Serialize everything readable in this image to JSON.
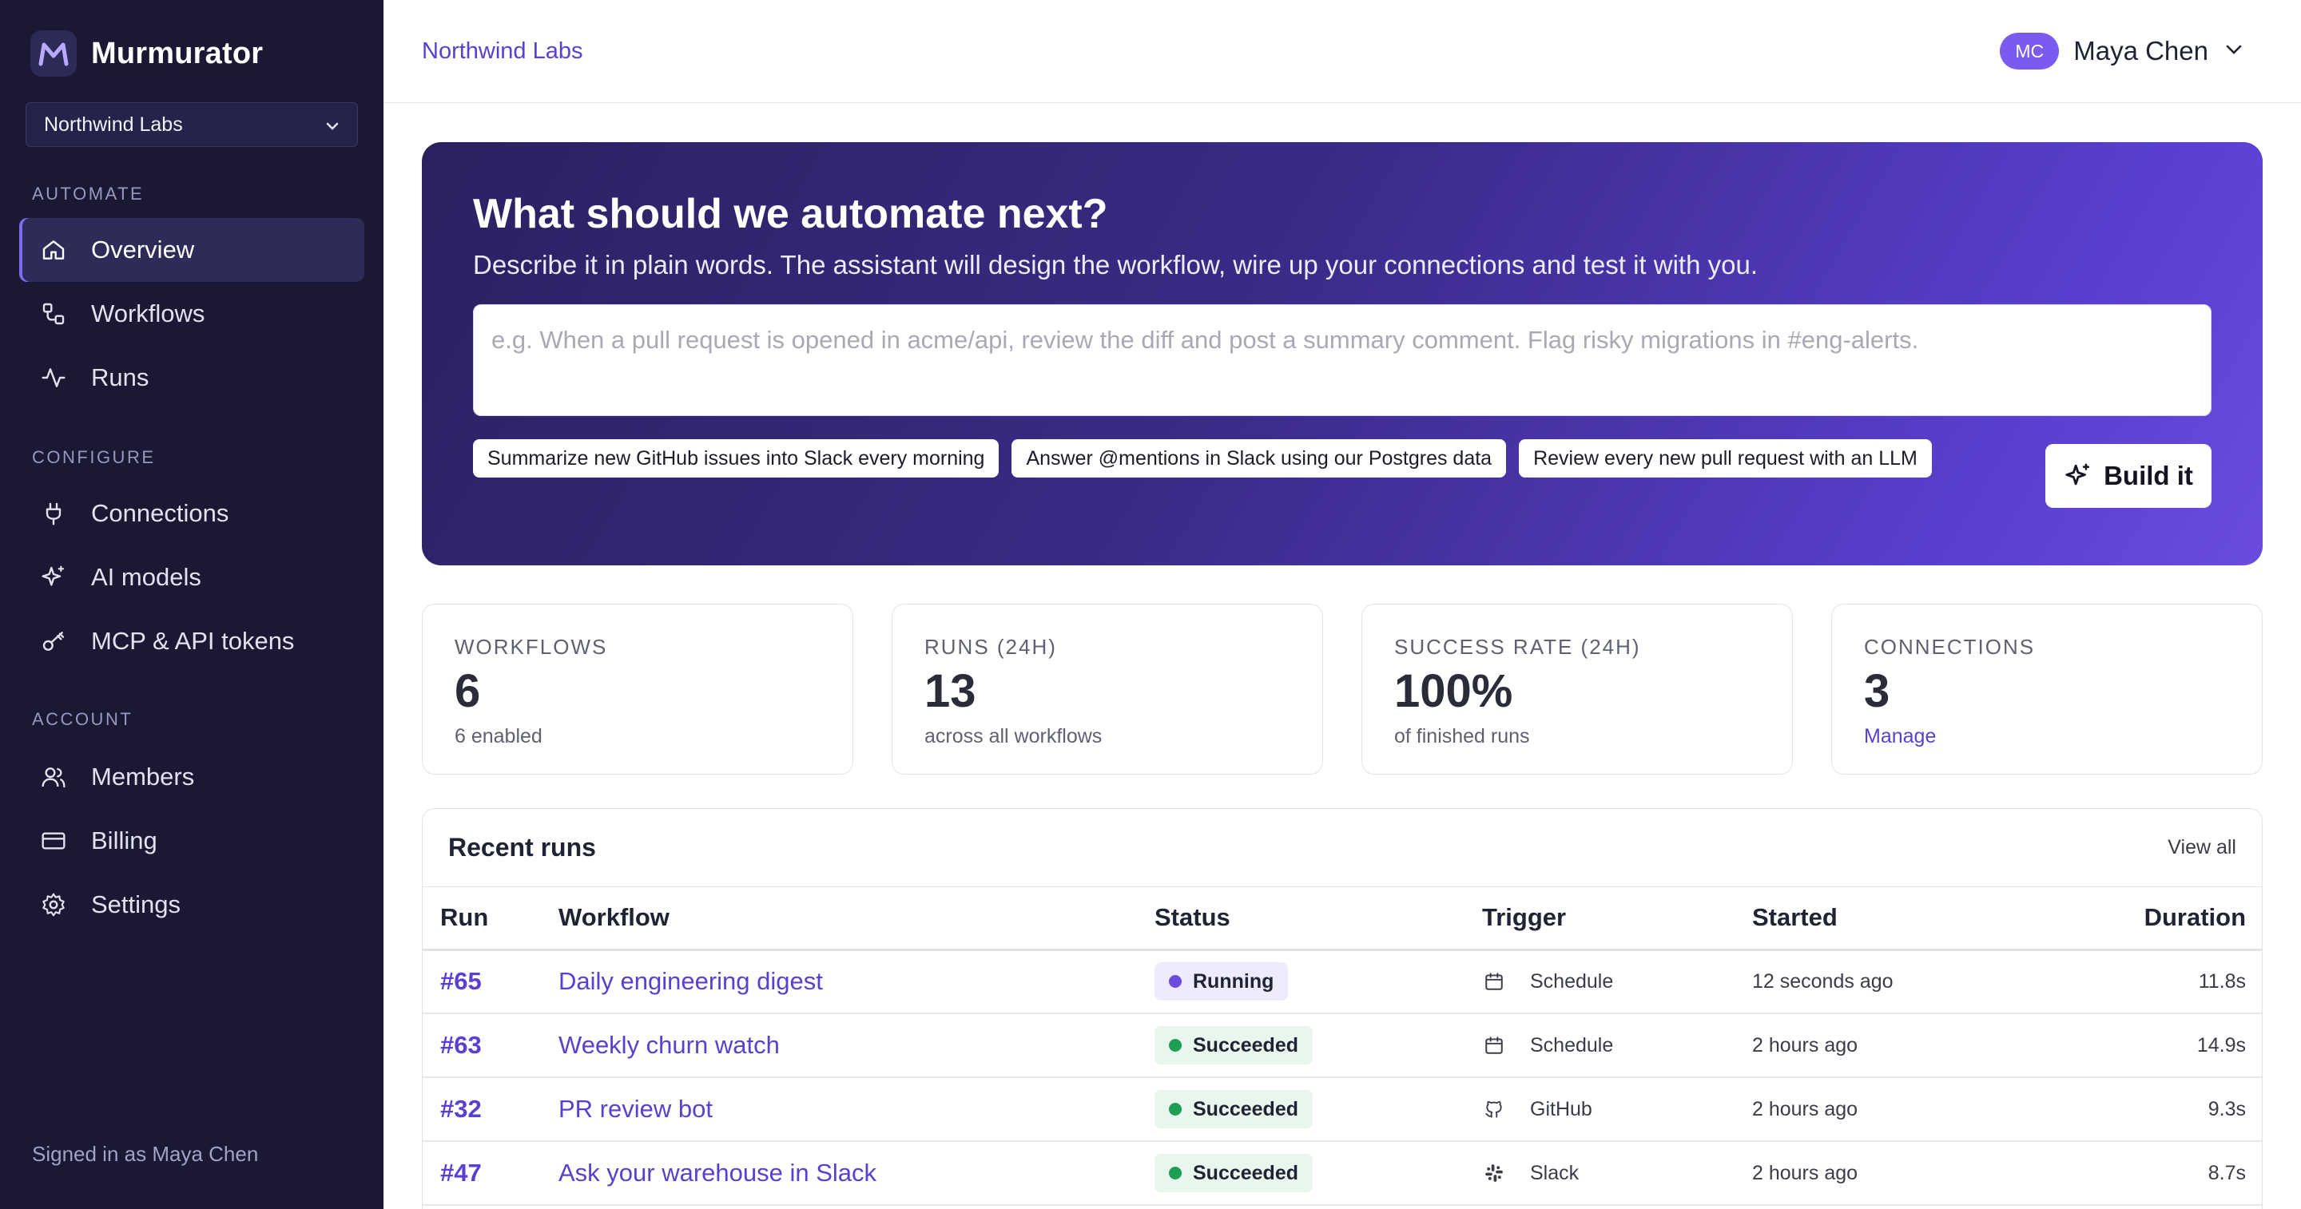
{
  "app": {
    "name": "Murmurator"
  },
  "sidebar": {
    "org_select": "Northwind Labs",
    "sections": [
      {
        "title": "AUTOMATE",
        "items": [
          {
            "label": "Overview",
            "icon": "home-icon",
            "active": true
          },
          {
            "label": "Workflows",
            "icon": "workflow-icon"
          },
          {
            "label": "Runs",
            "icon": "activity-icon"
          }
        ]
      },
      {
        "title": "CONFIGURE",
        "items": [
          {
            "label": "Connections",
            "icon": "plug-icon"
          },
          {
            "label": "AI models",
            "icon": "sparkles-icon"
          },
          {
            "label": "MCP & API tokens",
            "icon": "key-icon"
          }
        ]
      },
      {
        "title": "ACCOUNT",
        "items": [
          {
            "label": "Members",
            "icon": "users-icon"
          },
          {
            "label": "Billing",
            "icon": "credit-card-icon"
          },
          {
            "label": "Settings",
            "icon": "gear-icon"
          }
        ]
      }
    ],
    "signed_in": "Signed in as Maya Chen"
  },
  "topbar": {
    "org": "Northwind Labs",
    "user": {
      "initials": "MC",
      "name": "Maya Chen"
    }
  },
  "hero": {
    "title": "What should we automate next?",
    "subtitle": "Describe it in plain words. The assistant will design the workflow, wire up your connections and test it with you.",
    "placeholder": "e.g. When a pull request is opened in acme/api, review the diff and post a summary comment. Flag risky migrations in #eng-alerts.",
    "suggestions": [
      "Summarize new GitHub issues into Slack every morning",
      "Answer @mentions in Slack using our Postgres data",
      "Review every new pull request with an LLM"
    ],
    "build_label": "Build it"
  },
  "stats": [
    {
      "label": "WORKFLOWS",
      "value": "6",
      "sub": "6 enabled"
    },
    {
      "label": "RUNS (24H)",
      "value": "13",
      "sub": "across all workflows"
    },
    {
      "label": "SUCCESS RATE (24H)",
      "value": "100%",
      "sub": "of finished runs"
    },
    {
      "label": "CONNECTIONS",
      "value": "3",
      "sub": "Manage"
    }
  ],
  "recent_runs": {
    "title": "Recent runs",
    "view_all": "View all",
    "columns": [
      "Run",
      "Workflow",
      "Status",
      "Trigger",
      "Started",
      "Duration"
    ],
    "rows": [
      {
        "run": "#65",
        "workflow": "Daily engineering digest",
        "status": "Running",
        "trigger": "Schedule",
        "started": "12 seconds ago",
        "duration": "11.8s"
      },
      {
        "run": "#63",
        "workflow": "Weekly churn watch",
        "status": "Succeeded",
        "trigger": "Schedule",
        "started": "2 hours ago",
        "duration": "14.9s"
      },
      {
        "run": "#32",
        "workflow": "PR review bot",
        "status": "Succeeded",
        "trigger": "GitHub",
        "started": "2 hours ago",
        "duration": "9.3s"
      },
      {
        "run": "#47",
        "workflow": "Ask your warehouse in Slack",
        "status": "Succeeded",
        "trigger": "Slack",
        "started": "2 hours ago",
        "duration": "8.7s"
      }
    ]
  },
  "colors": {
    "sidebar_bg": "#1a1833",
    "accent": "#5b3fd0",
    "running": "#6b4be0",
    "succeeded": "#1f9d55"
  }
}
